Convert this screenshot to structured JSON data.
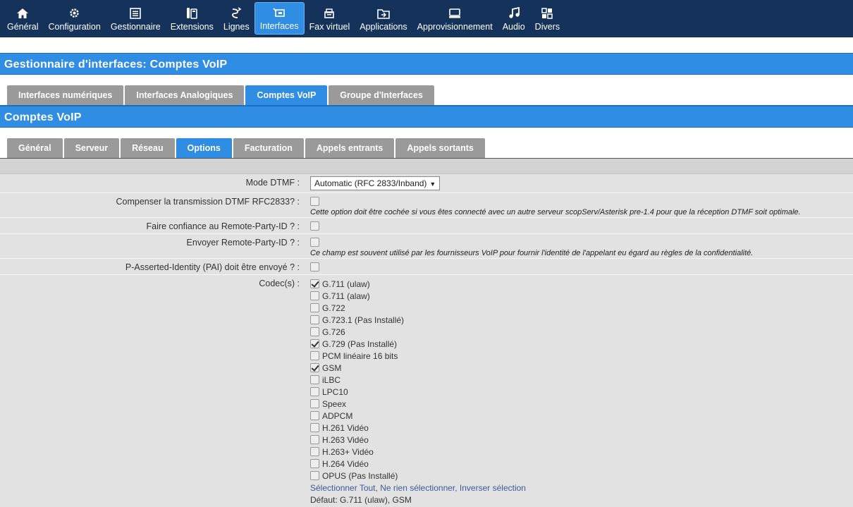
{
  "nav": [
    {
      "label": "Général",
      "icon": "home-icon"
    },
    {
      "label": "Configuration",
      "icon": "gear-icon"
    },
    {
      "label": "Gestionnaire",
      "icon": "list-icon"
    },
    {
      "label": "Extensions",
      "icon": "phone-icon"
    },
    {
      "label": "Lignes",
      "icon": "route-icon"
    },
    {
      "label": "Interfaces",
      "icon": "interface-icon"
    },
    {
      "label": "Fax virtuel",
      "icon": "fax-icon"
    },
    {
      "label": "Applications",
      "icon": "applications-icon"
    },
    {
      "label": "Approvisionnement",
      "icon": "provisioning-icon"
    },
    {
      "label": "Audio",
      "icon": "music-icon"
    },
    {
      "label": "Divers",
      "icon": "grid-icon"
    }
  ],
  "page_title": "Gestionnaire d'interfaces:  Comptes VoIP",
  "main_tabs": [
    "Interfaces numériques",
    "Interfaces Analogiques",
    "Comptes VoIP",
    "Groupe d'Interfaces"
  ],
  "section_title": "Comptes VoIP",
  "sub_tabs": [
    "Général",
    "Serveur",
    "Réseau",
    "Options",
    "Facturation",
    "Appels entrants",
    "Appels sortants"
  ],
  "form": {
    "dtmf_label": "Mode DTMF  :",
    "dtmf_value": "Automatic (RFC 2833/Inband)",
    "comp_label": "Compenser la transmission DTMF RFC2833?  :",
    "comp_help": "Cette option doit être cochée si vous êtes connecté avec un autre serveur scopServ/Asterisk pre-1.4 pour que la réception DTMF soit optimale.",
    "trust_label": "Faire confiance au Remote-Party-ID ?  :",
    "send_label": "Envoyer Remote-Party-ID ?  :",
    "send_help": "Ce champ est souvent utilisé par les fournisseurs VoIP pour fournir l'identité de l'appelant eu égard au règles de la confidentialité.",
    "pai_label": "P-Asserted-Identity (PAI) doit être envoyé ?  :",
    "codec_label": "Codec(s)  :",
    "codecs": [
      {
        "name": "G.711 (ulaw)",
        "checked": true
      },
      {
        "name": "G.711 (alaw)",
        "checked": false
      },
      {
        "name": "G.722",
        "checked": false
      },
      {
        "name": "G.723.1 (Pas Installé)",
        "checked": false
      },
      {
        "name": "G.726",
        "checked": false
      },
      {
        "name": "G.729 (Pas Installé)",
        "checked": true
      },
      {
        "name": "PCM linéaire 16 bits",
        "checked": false
      },
      {
        "name": "GSM",
        "checked": true
      },
      {
        "name": "iLBC",
        "checked": false
      },
      {
        "name": "LPC10",
        "checked": false
      },
      {
        "name": "Speex",
        "checked": false
      },
      {
        "name": "ADPCM",
        "checked": false
      },
      {
        "name": "H.261 Vidéo",
        "checked": false
      },
      {
        "name": "H.263 Vidéo",
        "checked": false
      },
      {
        "name": "H.263+ Vidéo",
        "checked": false
      },
      {
        "name": "H.264 Vidéo",
        "checked": false
      },
      {
        "name": "OPUS (Pas Installé)",
        "checked": false
      }
    ],
    "select_all": "Sélectionner Tout",
    "select_none": "Ne rien sélectionner",
    "invert": "Inverser sélection",
    "default_text": "Défaut: G.711 (ulaw), GSM"
  }
}
